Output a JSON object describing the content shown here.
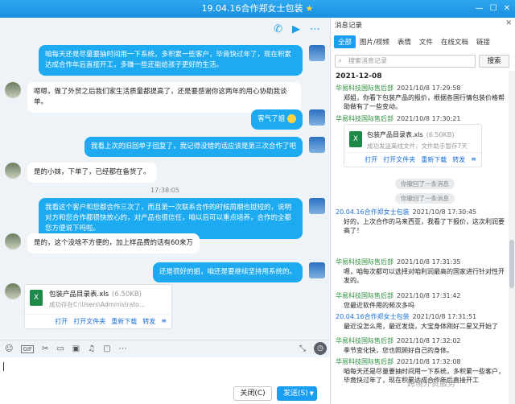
{
  "window": {
    "title": "19.04.16合作郑女士包装",
    "star": "★"
  },
  "chat": {
    "messages": [
      {
        "side": "me",
        "text": "咱每天还是尽量要抽时间用一下系统，多积累一些客户，毕竟快过年了，现在积累达成合作年后直接开工，多赚一些还能给孩子更好的生活。"
      },
      {
        "side": "them",
        "text": "嗯嗯，做了外贸之后我们家生活质量都提高了，还是要感谢你这两年的用心协助我谈单。"
      },
      {
        "side": "me",
        "text": "客气了姐"
      },
      {
        "side": "me",
        "text": "我看上次的旧回单子回复了，我记得没错的话应该是第三次合作了吧"
      },
      {
        "side": "them",
        "text": "是的小妹，下单了，已经都在备货了。"
      },
      {
        "side": "me",
        "text": "我看这个客户和您都合作三次了，而且第一次联系合作的时候周期也挺短的，说明对方和您合作都很快放心的，对产品也很信任，咱以后可以重点培养，合作的全都您方便说下吗啦。"
      },
      {
        "side": "them",
        "text": "是的，这个没啥不方便的，加上样品费的话有60来万"
      },
      {
        "side": "me",
        "text": "还是很好的姐，咱还是要继续坚持用系统的。"
      }
    ],
    "timestamp": "17:38:05",
    "file": {
      "name": "包装产品目录表.xls",
      "size": "(6.50KB)",
      "status": "成功存在C:\\Users\\Administrato...",
      "actions": [
        "打开",
        "打开文件夹",
        "重新下载",
        "转发"
      ]
    },
    "toolbar_icons": [
      "emoji-icon",
      "gif-icon",
      "scissors-icon",
      "folder-icon",
      "image-icon",
      "music-icon",
      "screen-icon",
      "more-icon",
      "clock-icon"
    ],
    "close_label": "关闭(C)",
    "send_label": "发送(S)"
  },
  "sidebar": {
    "title": "消息记录",
    "tabs": [
      "全部",
      "图片/视频",
      "表情",
      "文件",
      "在线文档",
      "链接"
    ],
    "search_placeholder": "搜索消息记录",
    "search_button": "搜索",
    "date": "2021-12-08",
    "entries": [
      {
        "name": "华易科技国际售后部",
        "time": "2021/10/8 17:29:58",
        "text": "郑姐，你看下包装产品的报价，根据各国行情包装价格帮助做有了一些变动。"
      },
      {
        "name": "华易科技国际售后部",
        "time": "2021/10/8 17:30:21",
        "text": ""
      },
      {
        "name": "20.04.16合作郑女士包装",
        "time": "2021/10/8 17:30:45",
        "text": "好的，上次合作的马来西亚，我看了下报价，这次利润要高了！"
      },
      {
        "name": "华易科技国际售后部",
        "time": "2021/10/8 17:31:35",
        "text": "嗯，咱每次都可以选择对咱利润最高的国家进行针对性开发的。"
      },
      {
        "name": "华易科技国际售后部",
        "time": "2021/10/8 17:31:42",
        "text": "您最近软件用的频次多吗"
      },
      {
        "name": "20.04.16合作郑女士包装",
        "time": "2021/10/8 17:31:51",
        "text": "最近没怎么用，最近发烧，大宝身体刚好二星又开始了"
      },
      {
        "name": "华易科技国际售后部",
        "time": "2021/10/8 17:32:02",
        "text": "季节变化快，您也照顾好自己的身体。"
      },
      {
        "name": "华易科技国际售后部",
        "time": "2021/10/8 17:32:08",
        "text": "咱每天还是尽量要抽时间用一下系统，多积累一些客户，毕竟快过年了，现在积累达成合作年后直接开工"
      }
    ],
    "file": {
      "name": "包装产品目录表.xls",
      "size": "(6.50KB)",
      "status": "成功发送离线文件，文件助手暂存7天",
      "actions": [
        "打开",
        "打开文件夹",
        "重新下载",
        "转发"
      ]
    },
    "recall_text": "你撤回了一条消息"
  },
  "watermark": "跨境外贸服务"
}
